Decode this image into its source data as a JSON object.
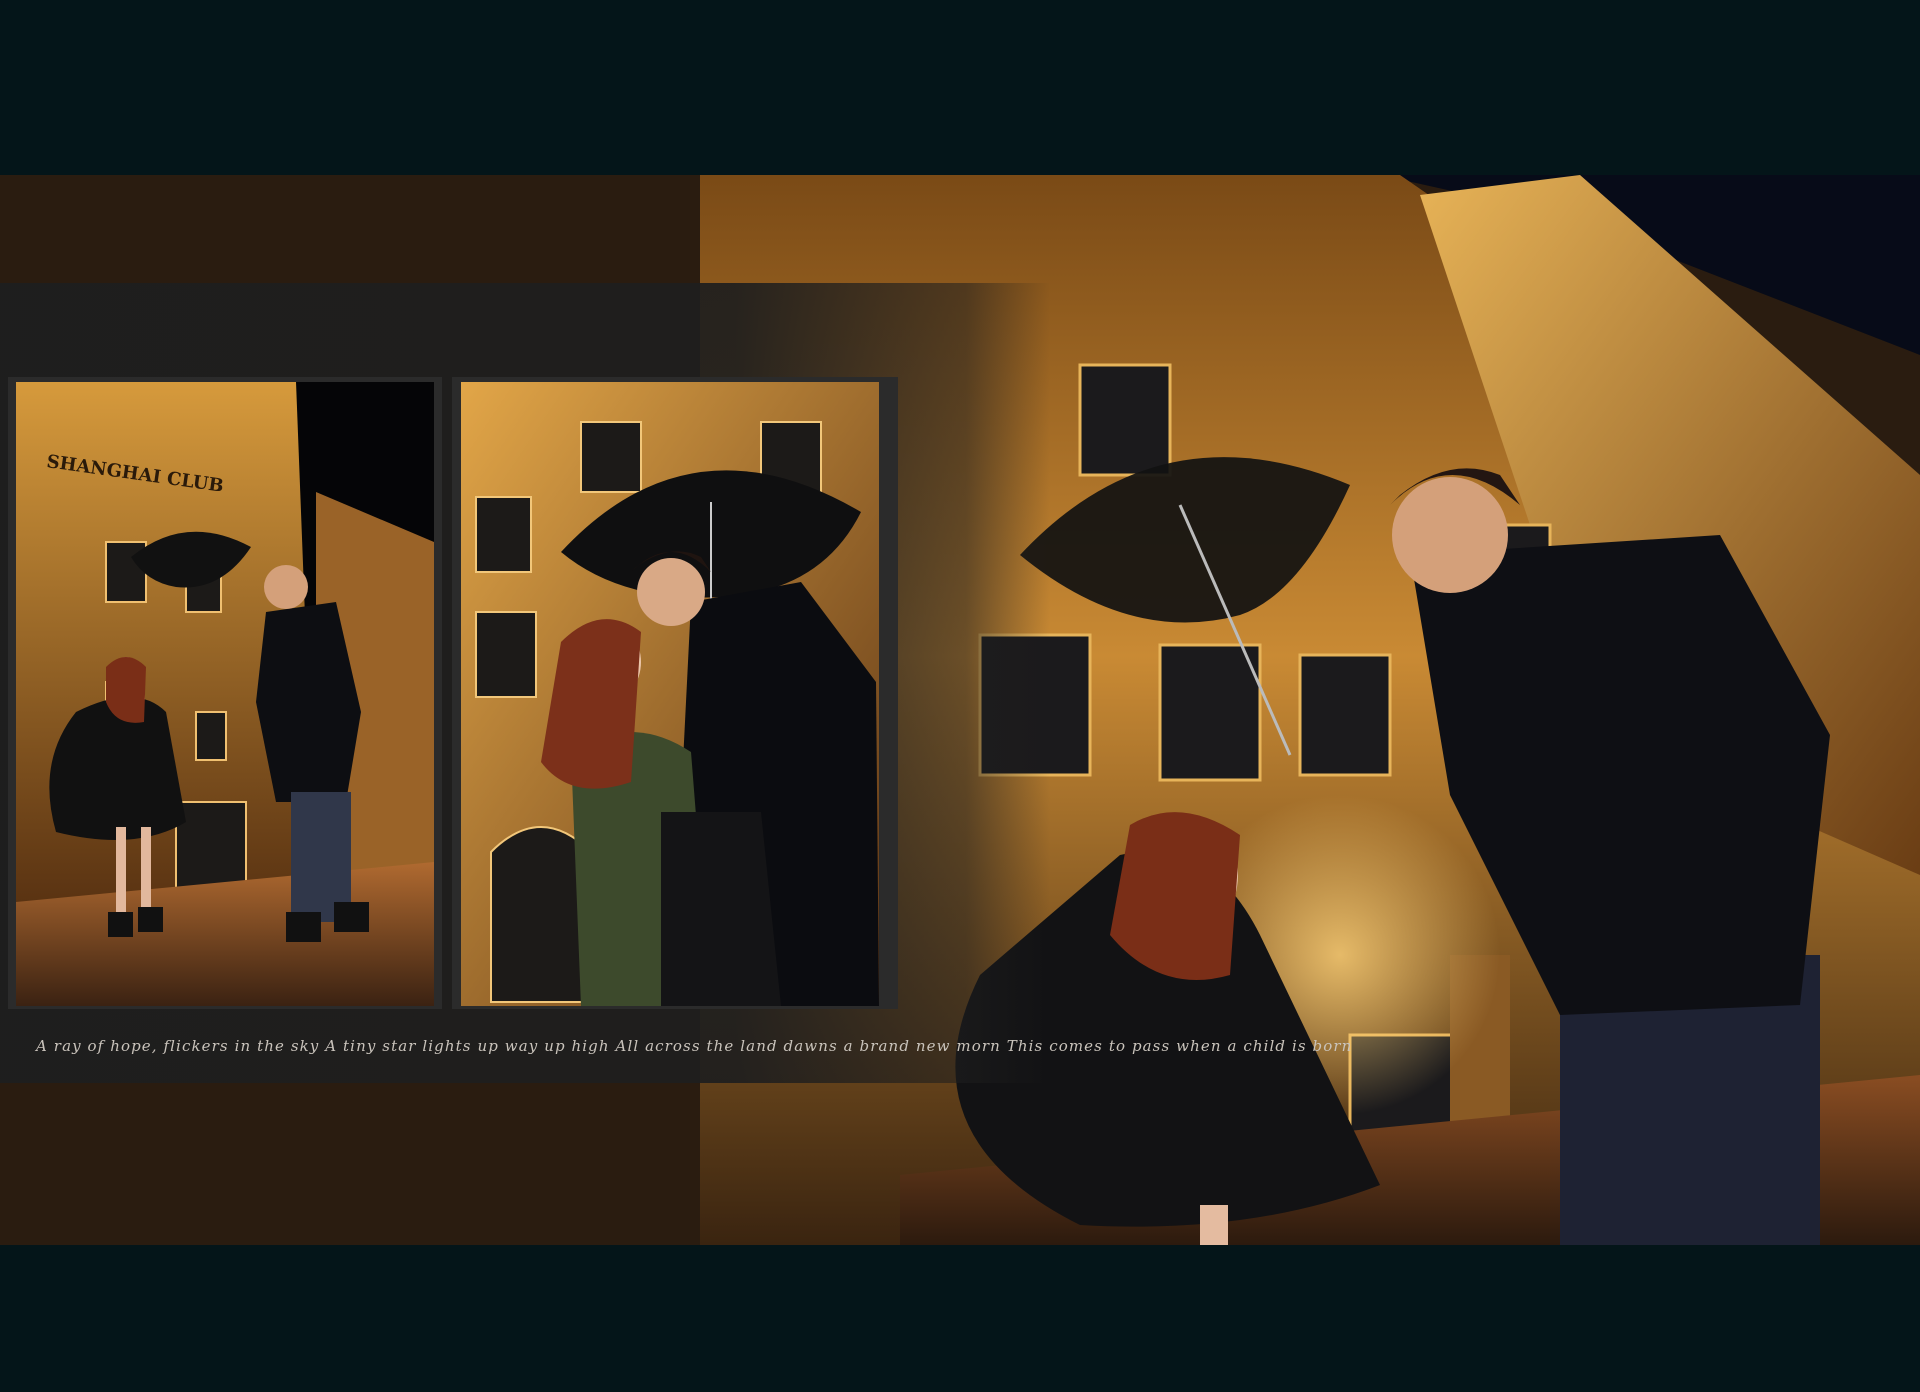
{
  "caption": "A ray of hope, flickers in the sky A tiny star lights up way up high All across the land dawns a brand new morn This comes to pass when a child is born",
  "sign_text": "SHANGHAI CLUB",
  "colors": {
    "outer_background": "#041519",
    "panel": "#1e1e1e",
    "night_sky": "#0a0f1c",
    "building_light": "#e0a23a",
    "building_shadow": "#6b3f12"
  },
  "photos": [
    {
      "name": "couple-with-umbrella-wide"
    },
    {
      "name": "couple-kissing-under-umbrella"
    },
    {
      "name": "couple-street-large"
    }
  ]
}
